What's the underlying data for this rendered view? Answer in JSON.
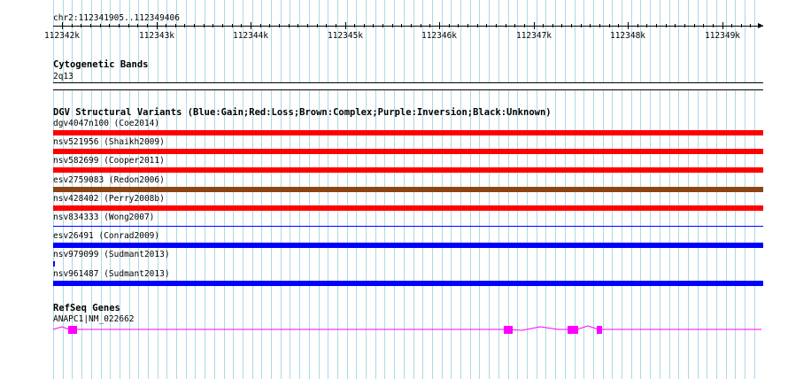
{
  "location": "chr2:112341905..112349406",
  "ruler": {
    "ticks": [
      "112342k",
      "112343k",
      "112344k",
      "112345k",
      "112346k",
      "112347k",
      "112348k",
      "112349k"
    ]
  },
  "tracks": {
    "cytoband": {
      "title": "Cytogenetic Bands",
      "band_label": "2q13"
    },
    "dgv": {
      "title": "DGV Structural Variants (Blue:Gain;Red:Loss;Brown:Complex;Purple:Inversion;Black:Unknown)",
      "variants": [
        {
          "label": "dgv4047n100 (Coe2014)",
          "type": "loss",
          "color": "#ff0000",
          "start": 112341905,
          "end": 112349406
        },
        {
          "label": "nsv521956 (Shaikh2009)",
          "type": "loss",
          "color": "#ff0000",
          "start": 112341905,
          "end": 112349406
        },
        {
          "label": "nsv582699 (Cooper2011)",
          "type": "loss",
          "color": "#ff0000",
          "start": 112341905,
          "end": 112349406
        },
        {
          "label": "esv2759083 (Redon2006)",
          "type": "complex",
          "color": "#8b4513",
          "start": 112341905,
          "end": 112349406
        },
        {
          "label": "nsv428402 (Perry2008b)",
          "type": "loss",
          "color": "#ff0000",
          "start": 112341905,
          "end": 112349406
        },
        {
          "label": "nsv834333 (Wong2007)",
          "type": "gain",
          "color": "#0000ff",
          "start": 112341905,
          "end": 112349406,
          "thin": true
        },
        {
          "label": "esv26491 (Conrad2009)",
          "type": "gain",
          "color": "#0000ff",
          "start": 112341905,
          "end": 112349406
        },
        {
          "label": "nsv979099 (Sudmant2013)",
          "type": "gain",
          "color": "#0000ff",
          "start": 112341905,
          "end": 112341920
        },
        {
          "label": "nsv961487 (Sudmant2013)",
          "type": "gain",
          "color": "#0000ff",
          "start": 112341905,
          "end": 112349406
        }
      ]
    },
    "refseq": {
      "title": "RefSeq Genes",
      "gene_label": "ANAPC1|NM_022662",
      "color": "#ff00ff"
    }
  },
  "colors": {
    "grid": "#add8e6",
    "gene": "#ff00ff"
  }
}
